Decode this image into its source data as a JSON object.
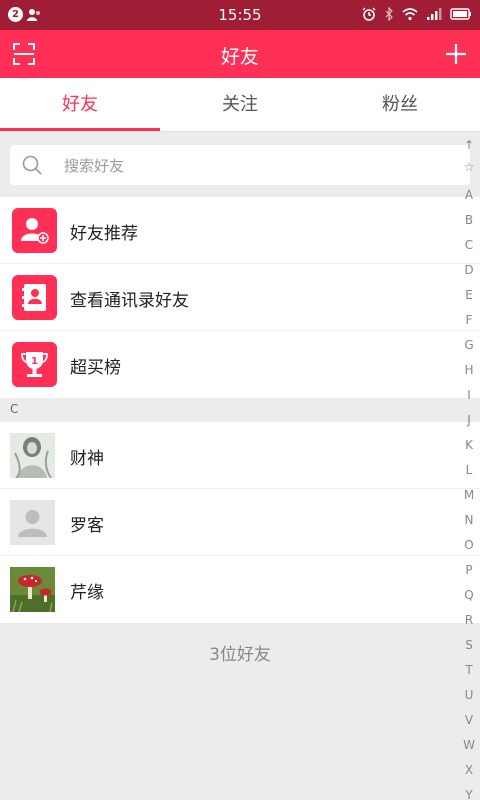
{
  "status_bar": {
    "notification_count": "2",
    "time": "15:55",
    "icons": [
      "user-icon",
      "alarm-icon",
      "bluetooth-icon",
      "wifi-icon",
      "signal-icon",
      "battery-icon"
    ]
  },
  "app_bar": {
    "title": "好友",
    "left_icon": "scan-icon",
    "right_icon": "plus-icon",
    "background": "#ff2f55"
  },
  "tabs": [
    {
      "label": "好友",
      "active": true
    },
    {
      "label": "关注",
      "active": false
    },
    {
      "label": "粉丝",
      "active": false
    }
  ],
  "search": {
    "placeholder": "搜索好友",
    "icon": "search-icon"
  },
  "features": [
    {
      "label": "好友推荐",
      "icon": "add-friend-icon"
    },
    {
      "label": "查看通讯录好友",
      "icon": "contacts-book-icon"
    },
    {
      "label": "超买榜",
      "icon": "trophy-icon",
      "icon_text": "1"
    }
  ],
  "section": {
    "letter": "C"
  },
  "friends": [
    {
      "name": "财神",
      "avatar": "photo-avatar-icon"
    },
    {
      "name": "罗客",
      "avatar": "default-avatar-icon"
    },
    {
      "name": "芹缘",
      "avatar": "mushroom-photo-icon"
    }
  ],
  "friend_count": "3位好友",
  "index_bar": {
    "top_symbols": [
      "↑",
      "☆"
    ],
    "letters": [
      "A",
      "B",
      "C",
      "D",
      "E",
      "F",
      "G",
      "H",
      "I",
      "J",
      "K",
      "L",
      "M",
      "N",
      "O",
      "P",
      "Q",
      "R",
      "S",
      "T",
      "U",
      "V",
      "W",
      "X",
      "Y"
    ]
  }
}
